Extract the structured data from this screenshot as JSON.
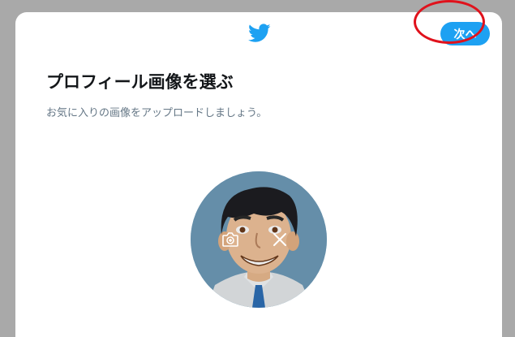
{
  "header": {
    "logo_icon": "twitter-bird-icon",
    "next_label": "次へ"
  },
  "content": {
    "title": "プロフィール画像を選ぶ",
    "subtitle": "お気に入りの画像をアップロードしましょう。"
  },
  "avatar": {
    "upload_icon": "camera-plus-icon",
    "remove_icon": "close-icon"
  },
  "colors": {
    "accent": "#1da1f2",
    "highlight": "#e0121c",
    "backdrop": "#a9a9a9"
  }
}
